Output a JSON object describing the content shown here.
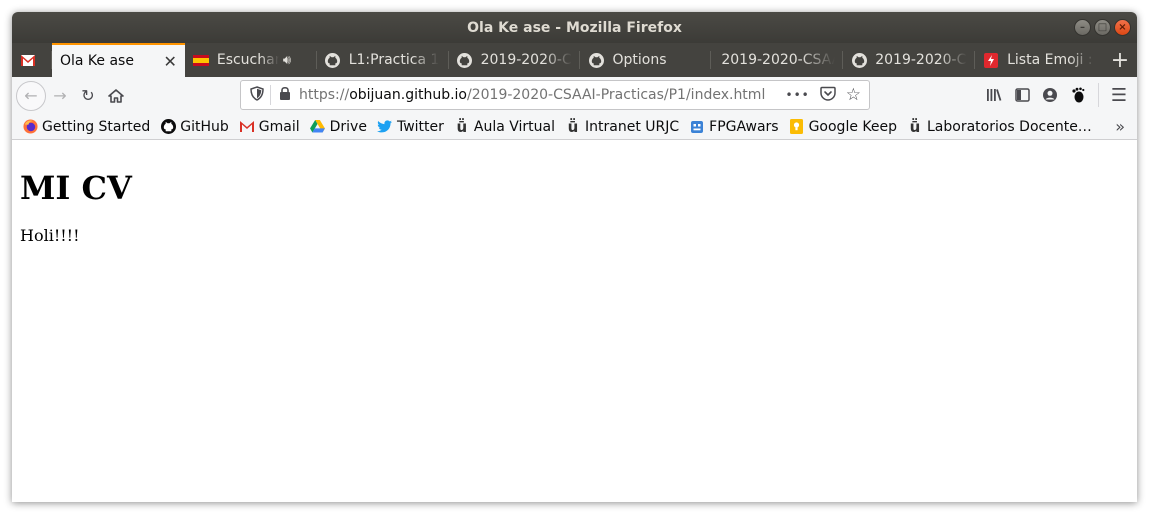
{
  "window": {
    "title": "Ola Ke ase - Mozilla Firefox",
    "controls": {
      "minimize": "–",
      "maximize": "□",
      "close": "×"
    }
  },
  "tabs": [
    {
      "label": "",
      "icon": "gmail-icon",
      "active": false
    },
    {
      "label": "Ola Ke ase",
      "icon": "",
      "active": true
    },
    {
      "label": "Escuchar L",
      "icon": "spain-flag-icon",
      "audio": true,
      "active": false
    },
    {
      "label": "L1:Practica 1",
      "icon": "github-icon",
      "active": false
    },
    {
      "label": "2019-2020-CS",
      "icon": "github-icon",
      "active": false
    },
    {
      "label": "Options",
      "icon": "github-icon",
      "active": false
    },
    {
      "label": "2019-2020-CSAA",
      "icon": "",
      "active": false
    },
    {
      "label": "2019-2020-CS",
      "icon": "github-icon",
      "active": false
    },
    {
      "label": "Lista Emoji : S",
      "icon": "flash-icon",
      "active": false
    }
  ],
  "newtab_label": "+",
  "url": {
    "scheme": "https://",
    "host": "obijuan.github.io",
    "path": "/2019-2020-CSAAI-Practicas/P1/index.html",
    "more": "•••"
  },
  "bookmarks": [
    {
      "label": "Getting Started",
      "icon": "firefox-icon"
    },
    {
      "label": "GitHub",
      "icon": "github-icon"
    },
    {
      "label": "Gmail",
      "icon": "gmail-icon"
    },
    {
      "label": "Drive",
      "icon": "drive-icon"
    },
    {
      "label": "Twitter",
      "icon": "twitter-icon"
    },
    {
      "label": "Aula Virtual",
      "icon": "urjc-icon"
    },
    {
      "label": "Intranet URJC",
      "icon": "urjc-icon"
    },
    {
      "label": "FPGAwars",
      "icon": "fpgawars-icon"
    },
    {
      "label": "Google Keep",
      "icon": "keep-icon"
    },
    {
      "label": "Laboratorios Docente…",
      "icon": "urjc-icon"
    }
  ],
  "bookmarks_more": "»",
  "page": {
    "heading": "MI CV",
    "paragraph": "Holi!!!!"
  },
  "colors": {
    "titlebar": "#3c3b37",
    "tab_accent": "#ff9400",
    "toolbar": "#f5f6f7"
  }
}
